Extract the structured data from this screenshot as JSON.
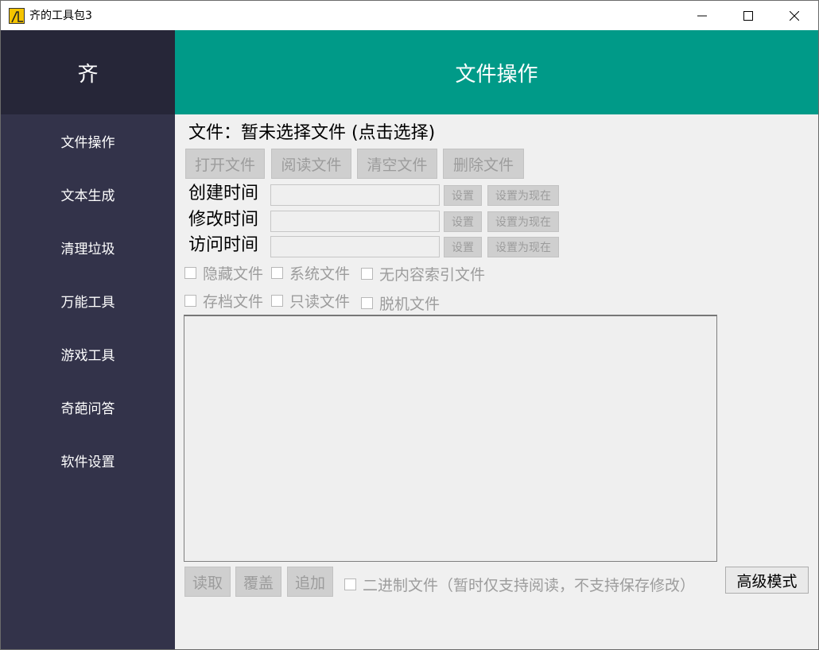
{
  "window": {
    "title": "齐的工具包3",
    "controls": {
      "minimize": "minimize",
      "maximize": "maximize",
      "close": "close"
    }
  },
  "sidebar": {
    "header": "齐",
    "items": [
      {
        "label": "文件操作"
      },
      {
        "label": "文本生成"
      },
      {
        "label": "清理垃圾"
      },
      {
        "label": "万能工具"
      },
      {
        "label": "游戏工具"
      },
      {
        "label": "奇葩问答"
      },
      {
        "label": "软件设置"
      }
    ]
  },
  "main": {
    "header": "文件操作",
    "file_label": "文件：暂未选择文件 (点击选择)",
    "file_buttons": {
      "open": "打开文件",
      "read": "阅读文件",
      "clear": "清空文件",
      "delete": "删除文件"
    },
    "times": [
      {
        "label": "创建时间",
        "value": "",
        "set": "设置",
        "set_now": "设置为现在"
      },
      {
        "label": "修改时间",
        "value": "",
        "set": "设置",
        "set_now": "设置为现在"
      },
      {
        "label": "访问时间",
        "value": "",
        "set": "设置",
        "set_now": "设置为现在"
      }
    ],
    "attributes": {
      "hidden": "隐藏文件",
      "system": "系统文件",
      "not_indexed": "无内容索引文件",
      "archive": "存档文件",
      "readonly": "只读文件",
      "offline": "脱机文件"
    },
    "content_text": "",
    "bottom": {
      "read": "读取",
      "overwrite": "覆盖",
      "append": "追加",
      "binary": "二进制文件（暂时仅支持阅读，不支持保存修改）",
      "advanced": "高级模式"
    }
  },
  "colors": {
    "sidebar_bg": "#33334a",
    "sidebar_header_bg": "#262638",
    "accent_header": "#009a88",
    "disabled_text": "#9c9c9c"
  },
  "icons": {
    "app": "app-logo-icon",
    "minimize": "minimize-icon",
    "maximize": "maximize-icon",
    "close": "close-icon"
  }
}
